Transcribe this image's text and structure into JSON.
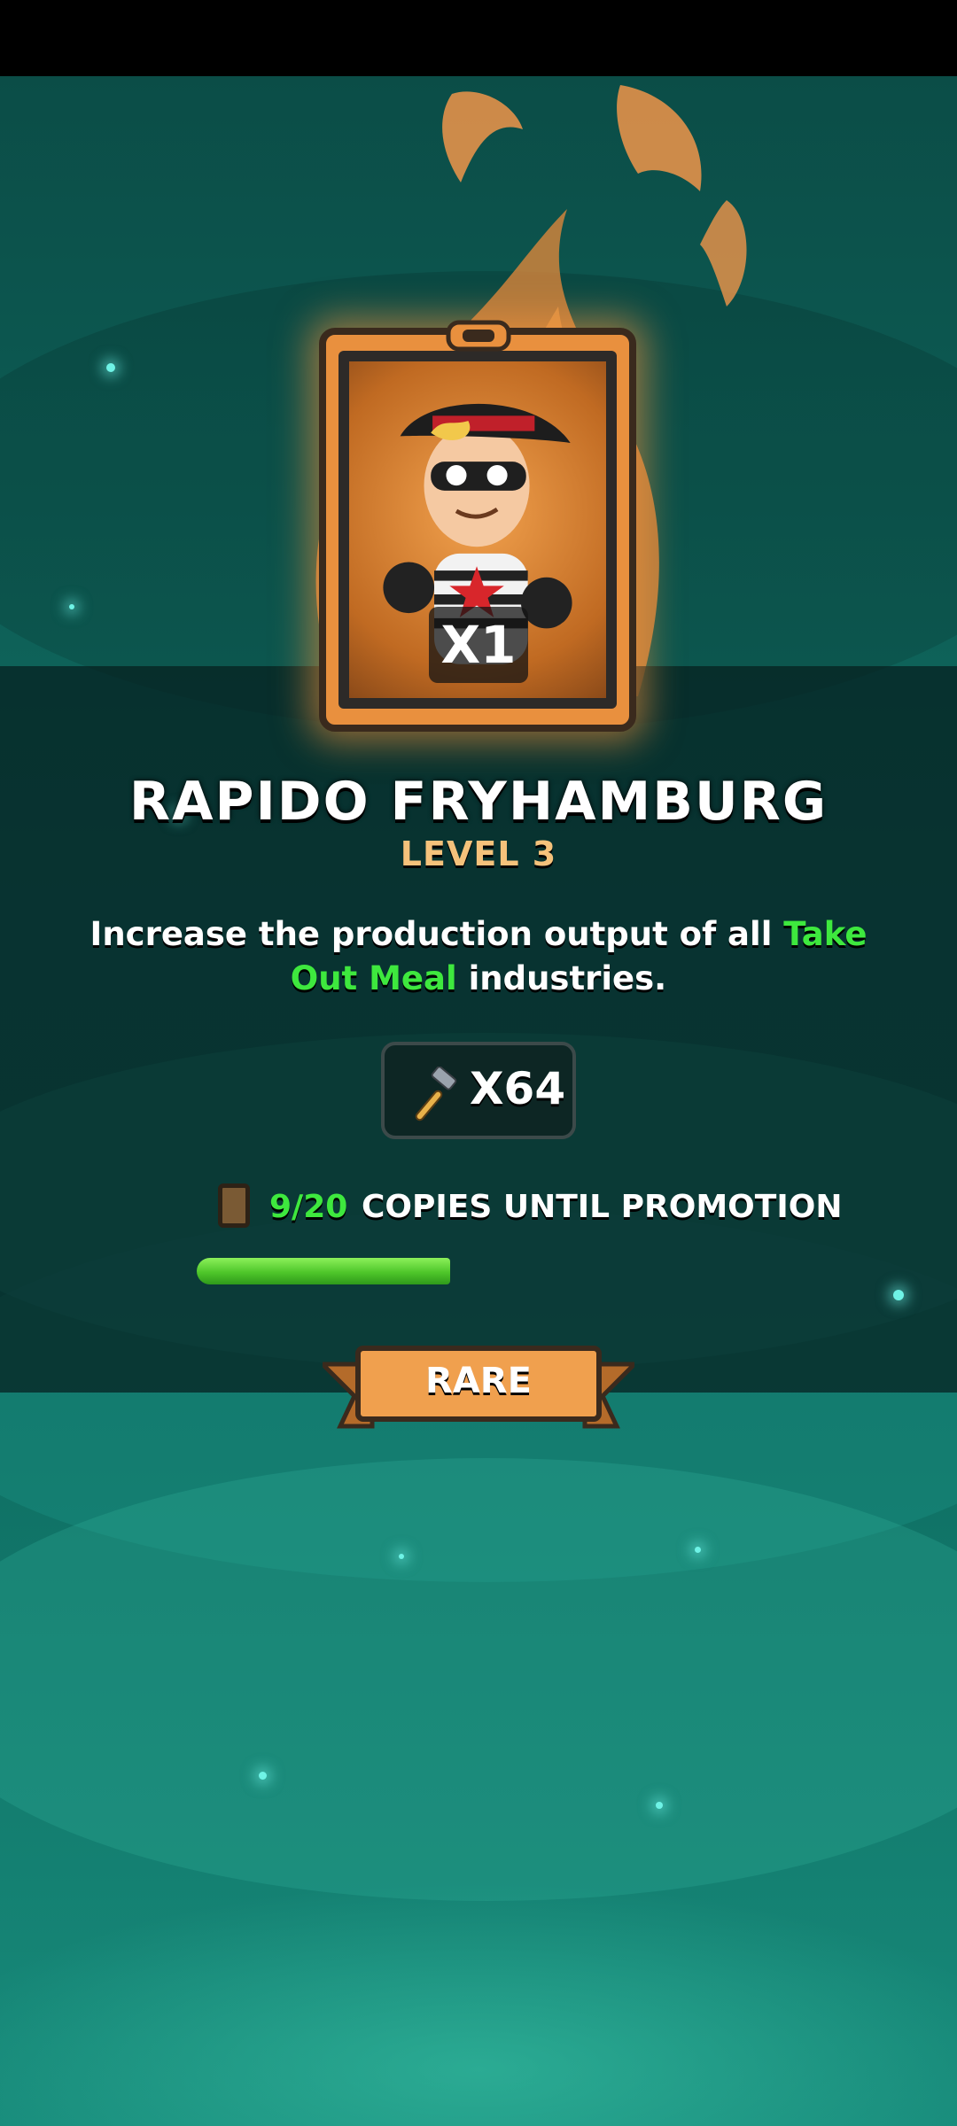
{
  "card": {
    "quantity": "X1",
    "name": "RAPIDO FRYHAMBURG",
    "level": "LEVEL 3",
    "description_parts": [
      "Increase the production output of all ",
      "Take Out Meal",
      " industries."
    ],
    "highlight_color": "#3ee83e",
    "rarity": "RARE"
  },
  "reward": {
    "icon": "hammer-icon",
    "amount": "X64"
  },
  "promotion": {
    "copies_text": "9/20",
    "label": "COPIES UNTIL PROMOTION",
    "progress": 0.45
  },
  "colors": {
    "accent_orange": "#e9903e",
    "level_gold": "#f5c27b",
    "progress_green": "#4ec62a"
  }
}
